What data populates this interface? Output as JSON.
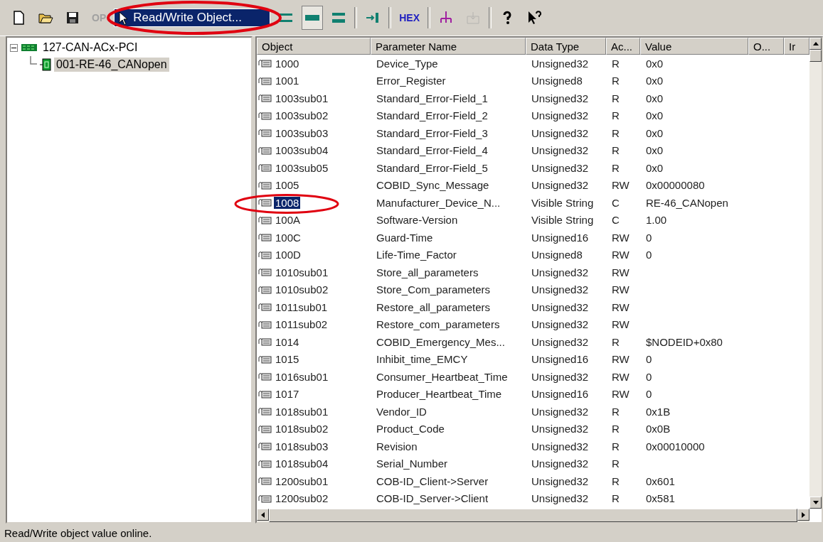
{
  "toolbar": [
    {
      "kind": "new"
    },
    {
      "kind": "open"
    },
    {
      "kind": "save"
    },
    {
      "kind": "text",
      "label": "OP",
      "disabled": true
    },
    {
      "kind": "menu",
      "label": "Read/Write Object..."
    },
    {
      "kind": "lines1"
    },
    {
      "kind": "lines2",
      "selected": true
    },
    {
      "kind": "lines3"
    },
    {
      "kind": "sep"
    },
    {
      "kind": "connect"
    },
    {
      "kind": "sep"
    },
    {
      "kind": "text",
      "label": "HEX",
      "disabled": false
    },
    {
      "kind": "sep"
    },
    {
      "kind": "tree"
    },
    {
      "kind": "import",
      "disabled": true
    },
    {
      "kind": "sep"
    },
    {
      "kind": "help"
    },
    {
      "kind": "whatsthis"
    }
  ],
  "tree": [
    {
      "label": "127-CAN-ACx-PCI",
      "expanded": true,
      "selected": false,
      "children": [
        {
          "label": "001-RE-46_CANopen",
          "selected": true
        }
      ]
    }
  ],
  "table": {
    "columns": [
      "Object",
      "Parameter Name",
      "Data Type",
      "Ac...",
      "Value",
      "O...",
      "Ir"
    ],
    "rows": [
      {
        "object": "1000",
        "name": "Device_Type",
        "type": "Unsigned32",
        "access": "R",
        "value": "0x0",
        "selected": false
      },
      {
        "object": "1001",
        "name": "Error_Register",
        "type": "Unsigned8",
        "access": "R",
        "value": "0x0",
        "selected": false
      },
      {
        "object": "1003sub01",
        "name": "Standard_Error-Field_1",
        "type": "Unsigned32",
        "access": "R",
        "value": "0x0",
        "selected": false
      },
      {
        "object": "1003sub02",
        "name": "Standard_Error-Field_2",
        "type": "Unsigned32",
        "access": "R",
        "value": "0x0",
        "selected": false
      },
      {
        "object": "1003sub03",
        "name": "Standard_Error-Field_3",
        "type": "Unsigned32",
        "access": "R",
        "value": "0x0",
        "selected": false
      },
      {
        "object": "1003sub04",
        "name": "Standard_Error-Field_4",
        "type": "Unsigned32",
        "access": "R",
        "value": "0x0",
        "selected": false
      },
      {
        "object": "1003sub05",
        "name": "Standard_Error-Field_5",
        "type": "Unsigned32",
        "access": "R",
        "value": "0x0",
        "selected": false
      },
      {
        "object": "1005",
        "name": "COBID_Sync_Message",
        "type": "Unsigned32",
        "access": "RW",
        "value": "0x00000080",
        "selected": false
      },
      {
        "object": "1008",
        "name": "Manufacturer_Device_N...",
        "type": "Visible String",
        "access": "C",
        "value": "RE-46_CANopen",
        "selected": true
      },
      {
        "object": "100A",
        "name": "Software-Version",
        "type": "Visible String",
        "access": "C",
        "value": "1.00",
        "selected": false
      },
      {
        "object": "100C",
        "name": "Guard-Time",
        "type": "Unsigned16",
        "access": "RW",
        "value": "0",
        "selected": false
      },
      {
        "object": "100D",
        "name": "Life-Time_Factor",
        "type": "Unsigned8",
        "access": "RW",
        "value": "0",
        "selected": false
      },
      {
        "object": "1010sub01",
        "name": "Store_all_parameters",
        "type": "Unsigned32",
        "access": "RW",
        "value": "",
        "selected": false
      },
      {
        "object": "1010sub02",
        "name": "Store_Com_parameters",
        "type": "Unsigned32",
        "access": "RW",
        "value": "",
        "selected": false
      },
      {
        "object": "1011sub01",
        "name": "Restore_all_parameters",
        "type": "Unsigned32",
        "access": "RW",
        "value": "",
        "selected": false
      },
      {
        "object": "1011sub02",
        "name": "Restore_com_parameters",
        "type": "Unsigned32",
        "access": "RW",
        "value": "",
        "selected": false
      },
      {
        "object": "1014",
        "name": "COBID_Emergency_Mes...",
        "type": "Unsigned32",
        "access": "R",
        "value": "$NODEID+0x80",
        "selected": false
      },
      {
        "object": "1015",
        "name": "Inhibit_time_EMCY",
        "type": "Unsigned16",
        "access": "RW",
        "value": "0",
        "selected": false
      },
      {
        "object": "1016sub01",
        "name": "Consumer_Heartbeat_Time",
        "type": "Unsigned32",
        "access": "RW",
        "value": "0",
        "selected": false
      },
      {
        "object": "1017",
        "name": "Producer_Heartbeat_Time",
        "type": "Unsigned16",
        "access": "RW",
        "value": "0",
        "selected": false
      },
      {
        "object": "1018sub01",
        "name": "Vendor_ID",
        "type": "Unsigned32",
        "access": "R",
        "value": "0x1B",
        "selected": false
      },
      {
        "object": "1018sub02",
        "name": "Product_Code",
        "type": "Unsigned32",
        "access": "R",
        "value": "0x0B",
        "selected": false
      },
      {
        "object": "1018sub03",
        "name": "Revision",
        "type": "Unsigned32",
        "access": "R",
        "value": "0x00010000",
        "selected": false
      },
      {
        "object": "1018sub04",
        "name": "Serial_Number",
        "type": "Unsigned32",
        "access": "R",
        "value": "",
        "selected": false
      },
      {
        "object": "1200sub01",
        "name": "COB-ID_Client->Server",
        "type": "Unsigned32",
        "access": "R",
        "value": "0x601",
        "selected": false
      },
      {
        "object": "1200sub02",
        "name": "COB-ID_Server->Client",
        "type": "Unsigned32",
        "access": "R",
        "value": "0x581",
        "selected": false
      }
    ]
  },
  "status_bar": "Read/Write object value online."
}
